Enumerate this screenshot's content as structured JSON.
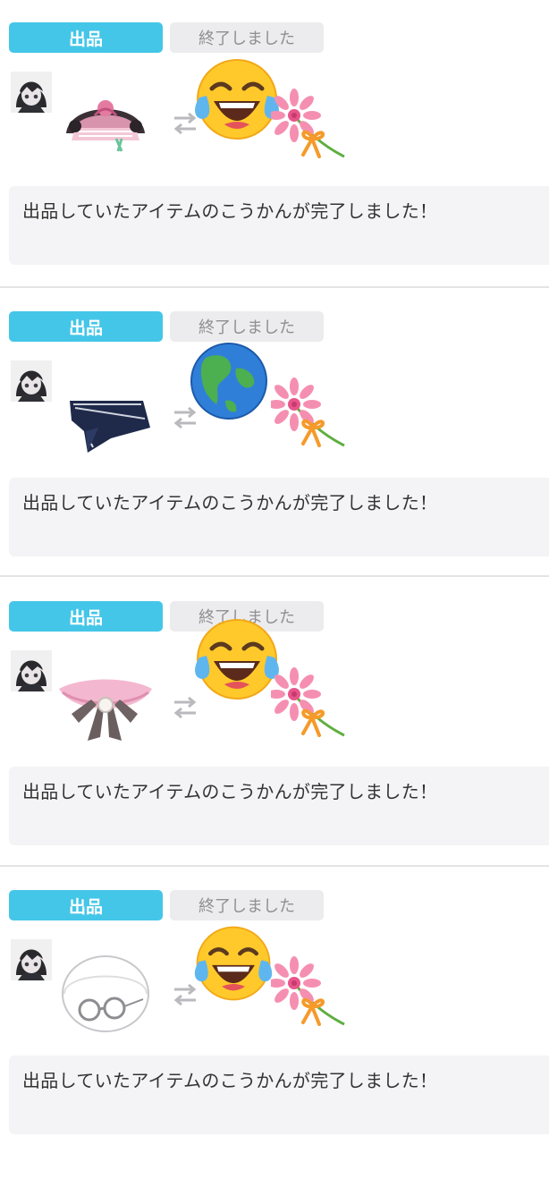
{
  "listings": [
    {
      "tag": "出品",
      "status": "終了しました",
      "item": "ribbon-skirt-icon",
      "reward": "face-with-tears-of-joy-icon",
      "message": "出品していたアイテムのこうかんが完了しました！"
    },
    {
      "tag": "出品",
      "status": "終了しました",
      "item": "sailor-collar-icon",
      "reward": "globe-americas-icon",
      "message": "出品していたアイテムのこうかんが完了しました！"
    },
    {
      "tag": "出品",
      "status": "終了しました",
      "item": "pink-bow-collar-icon",
      "reward": "face-with-tears-of-joy-icon",
      "message": "出品していたアイテムのこうかんが完了しました！"
    },
    {
      "tag": "出品",
      "status": "終了しました",
      "item": "round-glasses-icon",
      "reward": "face-with-tears-of-joy-icon",
      "message": "出品していたアイテムのこうかんが完了しました！"
    }
  ],
  "colors": {
    "tag_bg": "#44c6e8",
    "status_bg": "#ececee",
    "message_bg": "#f4f4f6"
  }
}
